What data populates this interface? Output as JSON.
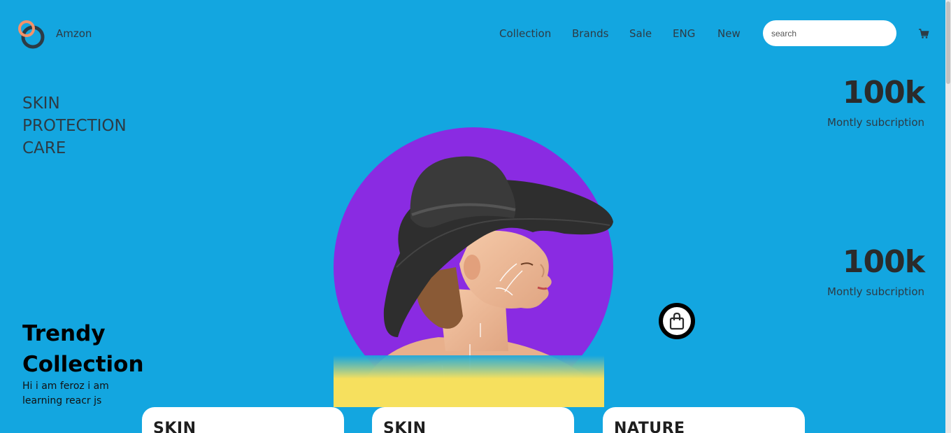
{
  "header": {
    "brand": "Amzon",
    "nav": [
      "Collection",
      "Brands",
      "Sale",
      "ENG",
      "New"
    ],
    "search_placeholder": "search",
    "icons": {
      "logo": "rings-logo",
      "cart": "cart-icon"
    }
  },
  "left": {
    "skin_care_lines": [
      "SKIN",
      "PROTECTION",
      "CARE"
    ],
    "trendy_lines": [
      "Trendy",
      "Collection"
    ],
    "intro": "Hi i am feroz i am learning reacr js"
  },
  "stats": [
    {
      "value": "100k",
      "label": "Montly subcription"
    },
    {
      "value": "100k",
      "label": "Montly subcription"
    }
  ],
  "cards": [
    {
      "title": "SKIN"
    },
    {
      "title": "SKIN"
    },
    {
      "title": "NATURE"
    }
  ],
  "colors": {
    "background": "#13a6e0",
    "circle": "#8a2be2",
    "hero_yellow": "#f6e05e",
    "logo_orange": "#f4926a",
    "logo_dark": "#2d3b45"
  },
  "icons": {
    "bag": "shopping-bag-icon"
  }
}
